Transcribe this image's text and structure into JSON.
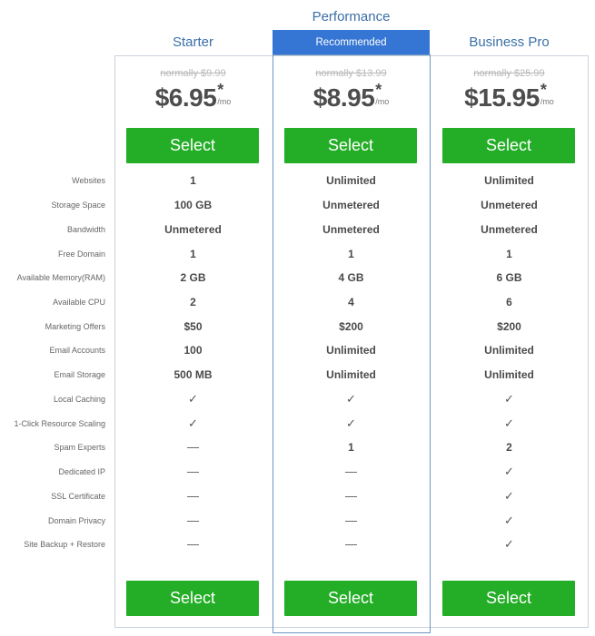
{
  "features": [
    "Websites",
    "Storage Space",
    "Bandwidth",
    "Free Domain",
    "Available Memory(RAM)",
    "Available CPU",
    "Marketing Offers",
    "Email Accounts",
    "Email Storage",
    "Local Caching",
    "1-Click Resource Scaling",
    "Spam Experts",
    "Dedicated IP",
    "SSL Certificate",
    "Domain Privacy",
    "Site Backup + Restore"
  ],
  "plans": [
    {
      "name": "Starter",
      "old_price": "normally $9.99",
      "price": "$6.95",
      "asterisk": "*",
      "per": "/mo",
      "select_label": "Select",
      "values": [
        "1",
        "100 GB",
        "Unmetered",
        "1",
        "2 GB",
        "2",
        "$50",
        "100",
        "500 MB",
        "✓",
        "✓",
        "—",
        "—",
        "—",
        "—",
        "—"
      ]
    },
    {
      "name": "Performance",
      "badge": "Recommended",
      "old_price": "normally $13.99",
      "price": "$8.95",
      "asterisk": "*",
      "per": "/mo",
      "select_label": "Select",
      "values": [
        "Unlimited",
        "Unmetered",
        "Unmetered",
        "1",
        "4 GB",
        "4",
        "$200",
        "Unlimited",
        "Unlimited",
        "✓",
        "✓",
        "1",
        "—",
        "—",
        "—",
        "—"
      ]
    },
    {
      "name": "Business Pro",
      "old_price": "normally $25.99",
      "price": "$15.95",
      "asterisk": "*",
      "per": "/mo",
      "select_label": "Select",
      "values": [
        "Unlimited",
        "Unmetered",
        "Unmetered",
        "1",
        "6 GB",
        "6",
        "$200",
        "Unlimited",
        "Unlimited",
        "✓",
        "✓",
        "2",
        "✓",
        "✓",
        "✓",
        "✓"
      ]
    }
  ],
  "colors": {
    "select_button": "#24ad26",
    "badge": "#3575d3",
    "plan_title": "#3b6fa8"
  }
}
